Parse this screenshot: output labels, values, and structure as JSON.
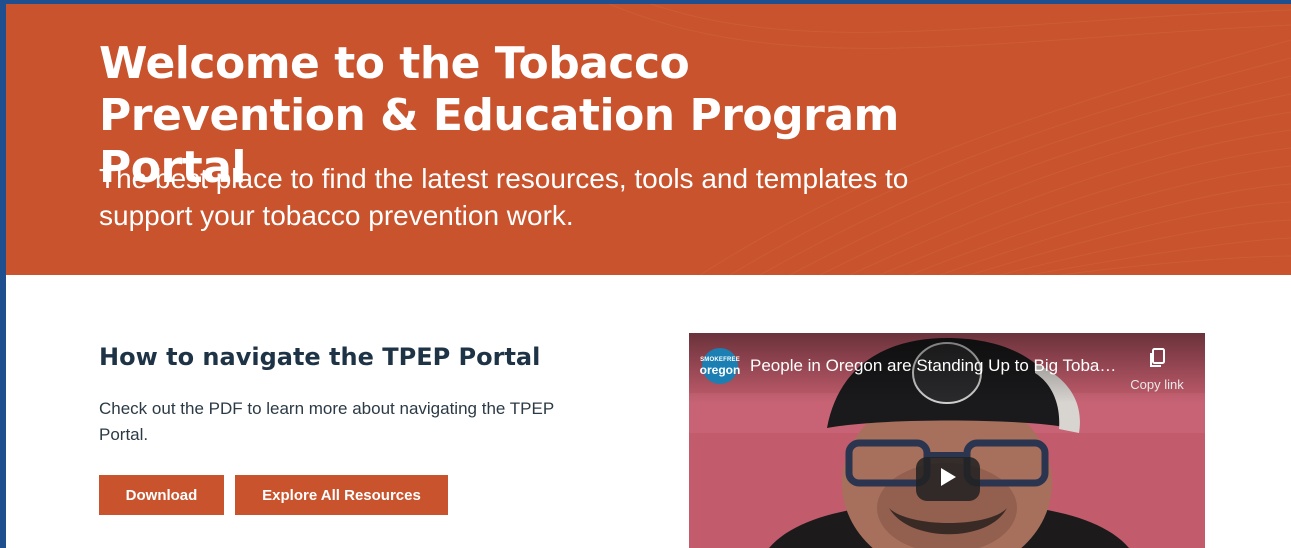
{
  "hero": {
    "title": "Welcome to the Tobacco Prevention & Education Program Portal",
    "subtitle": "The best place to find the latest resources, tools and templates to support your tobacco prevention work."
  },
  "navigate_section": {
    "title": "How to navigate the TPEP Portal",
    "description": "Check out the PDF to learn more about navigating the TPEP Portal.",
    "buttons": {
      "download": "Download",
      "explore": "Explore All Resources"
    }
  },
  "video": {
    "channel_logo_top": "SMOKEFREE",
    "channel_logo_bottom": "oregon",
    "title": "People in Oregon are Standing Up to Big Tobac...",
    "copy_link_label": "Copy link",
    "icons": {
      "copy": "copy-icon",
      "play": "play-icon"
    }
  },
  "colors": {
    "brand_orange": "#c8532c",
    "heading_navy": "#1e3345",
    "frame_blue": "#1f4f8f"
  }
}
